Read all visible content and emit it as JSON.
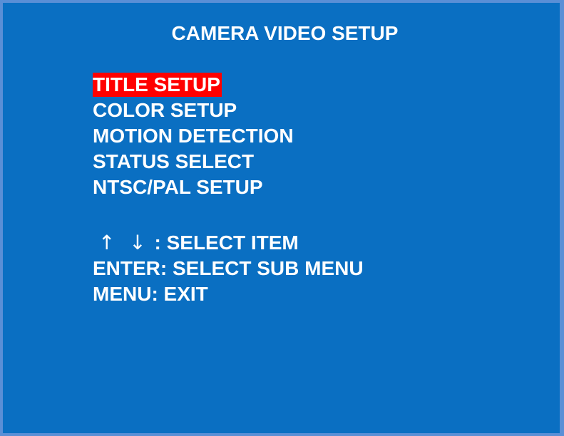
{
  "screen": {
    "title": "CAMERA VIDEO SETUP",
    "colors": {
      "background": "#0a6fc2",
      "border": "#5a8fd6",
      "text": "#ffffff",
      "selection": "#ff0000"
    }
  },
  "menu": {
    "selected_index": 0,
    "items": [
      {
        "label": "TITLE SETUP"
      },
      {
        "label": "COLOR SETUP"
      },
      {
        "label": "MOTION DETECTION"
      },
      {
        "label": "STATUS SELECT"
      },
      {
        "label": "NTSC/PAL SETUP"
      }
    ]
  },
  "help": {
    "up_arrow": "↑",
    "down_arrow": "↓",
    "select_item": ": SELECT ITEM",
    "enter_line": "ENTER: SELECT SUB MENU",
    "menu_line": "MENU: EXIT"
  }
}
